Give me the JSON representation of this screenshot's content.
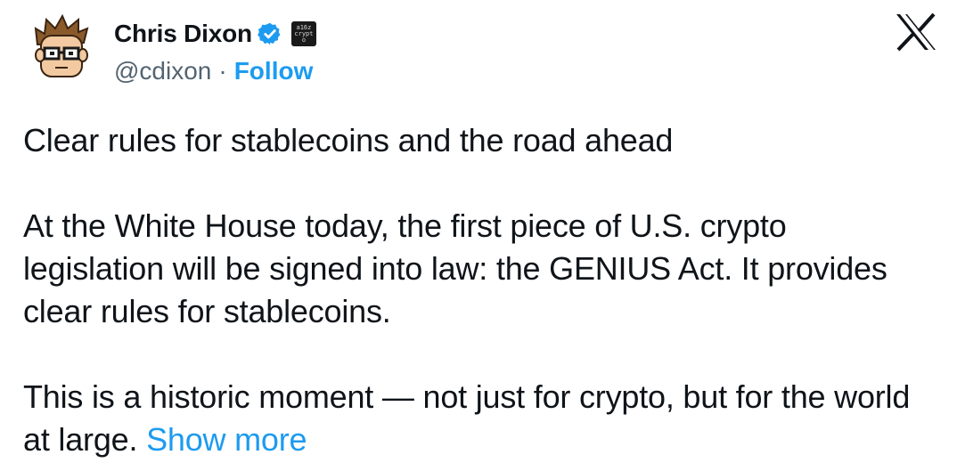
{
  "author": {
    "display_name": "Chris Dixon",
    "handle": "@cdixon",
    "separator": "·",
    "follow_label": "Follow",
    "affiliate_badge_text": "a16z crypto",
    "verified_color": "#1d9bf0"
  },
  "brand": {
    "logo_icon": "x-logo-icon"
  },
  "tweet": {
    "paragraphs": [
      "Clear rules for stablecoins and the road ahead",
      "At the White House today, the first piece of U.S. crypto legislation will be signed into law: the GENIUS Act. It provides clear rules for stablecoins.",
      "This is a historic moment — not just for crypto, but for the world at large."
    ],
    "show_more_label": "Show more"
  },
  "colors": {
    "text": "#0f1419",
    "secondary": "#536471",
    "accent": "#1d9bf0"
  }
}
